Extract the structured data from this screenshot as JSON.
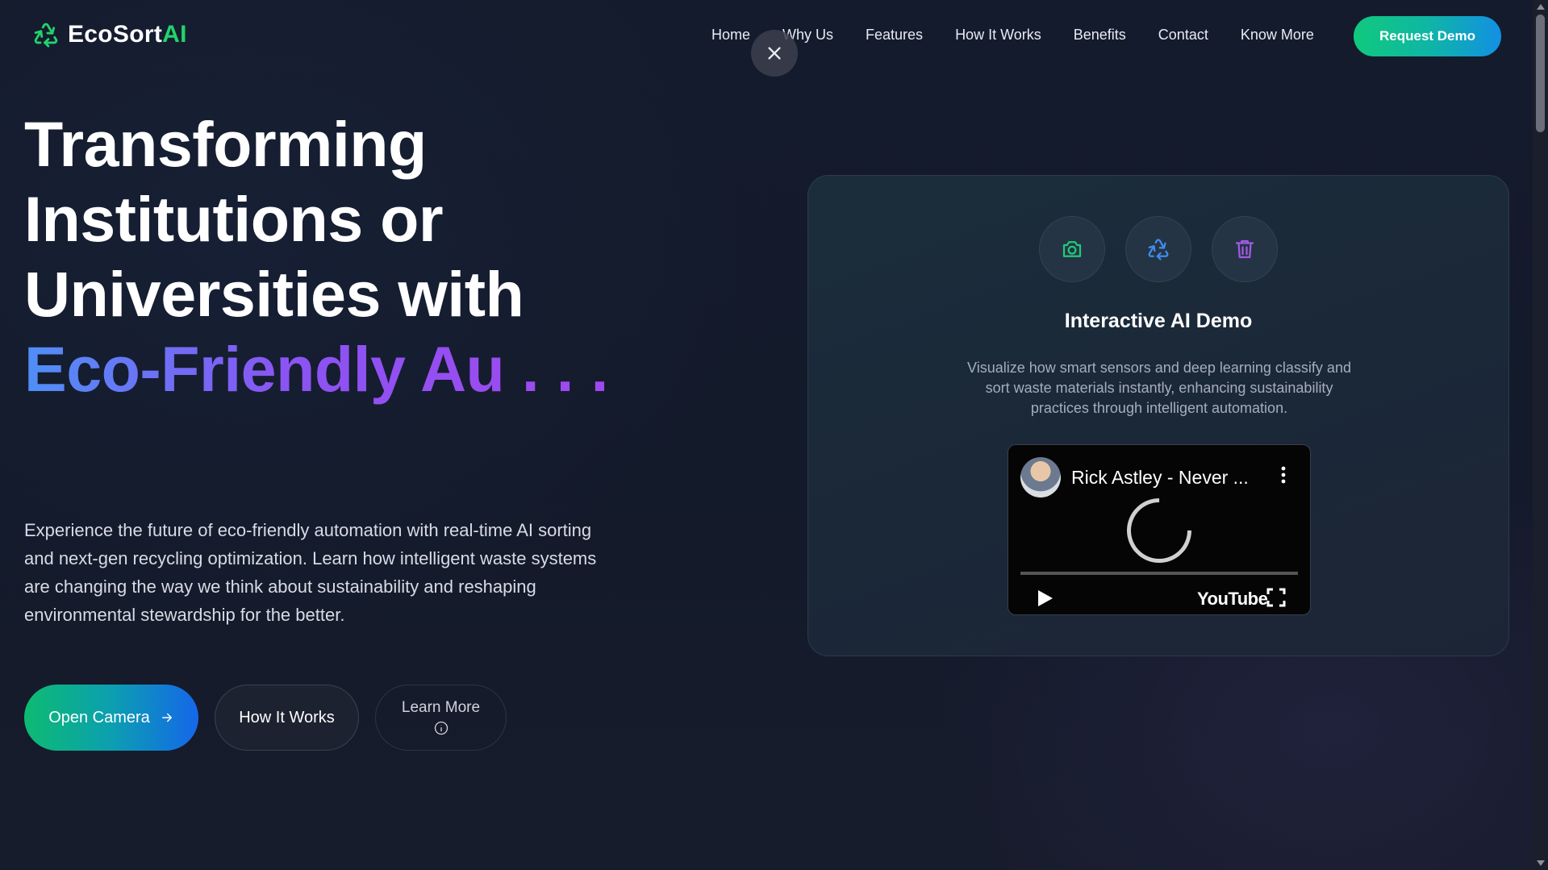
{
  "brand": {
    "name_main": "EcoSort",
    "name_accent": "AI",
    "accent_color": "#22d36b"
  },
  "nav": {
    "items": [
      {
        "label": "Home"
      },
      {
        "label": "Why Us"
      },
      {
        "label": "Features"
      },
      {
        "label": "How It Works"
      },
      {
        "label": "Benefits"
      },
      {
        "label": "Contact"
      },
      {
        "label": "Know More"
      }
    ],
    "cta_label": "Request Demo"
  },
  "hero": {
    "title_line1": "Transforming",
    "title_line2": "Institutions or",
    "title_line3": "Universities with",
    "title_line4": "Eco-Friendly Au . . .",
    "description": "Experience the future of eco-friendly automation with real-time AI sorting and next-gen recycling optimization. Learn how intelligent waste systems are changing the way we think about sustainability and reshaping environmental stewardship for the better.",
    "buttons": {
      "primary": "Open Camera",
      "secondary": "How It Works",
      "tertiary": "Learn More"
    }
  },
  "demo_card": {
    "icons": [
      "camera-icon",
      "recycle-icon",
      "trash-icon"
    ],
    "title": "Interactive AI Demo",
    "description": "Visualize how smart sensors and deep learning classify and sort waste materials instantly, enhancing sustainability practices through intelligent automation.",
    "video": {
      "title": "Rick Astley - Never ...",
      "platform": "YouTube"
    }
  },
  "colors": {
    "primary_gradient": [
      "#10c97d",
      "#1290e4"
    ],
    "title_gradient": [
      "#4f8ff7",
      "#a048ee"
    ],
    "background": "#131a2b"
  }
}
